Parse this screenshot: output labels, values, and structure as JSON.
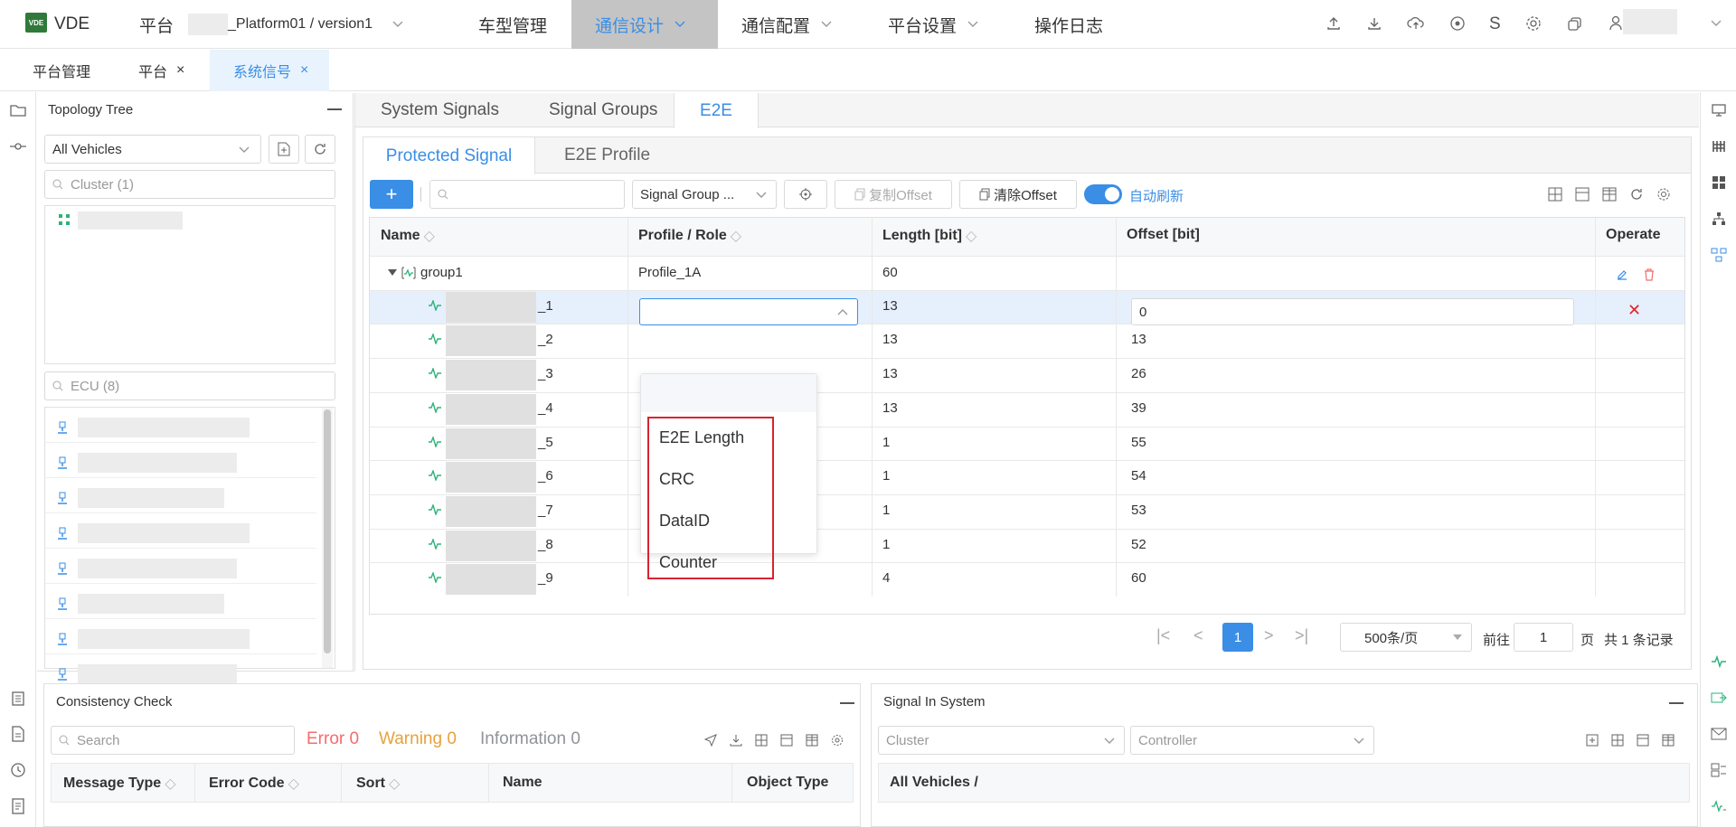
{
  "app": {
    "name": "VDE",
    "logo_text": "VDE"
  },
  "nav": {
    "platform_label": "平台",
    "platform_value": "_Platform01 / version1",
    "items": [
      {
        "label": "车型管理"
      },
      {
        "label": "通信设计",
        "active": true
      },
      {
        "label": "通信配置"
      },
      {
        "label": "平台设置"
      },
      {
        "label": "操作日志"
      }
    ],
    "user_initial": "S"
  },
  "page_tabs": [
    {
      "label": "平台管理",
      "closable": false
    },
    {
      "label": "平台",
      "closable": true
    },
    {
      "label": "系统信号",
      "closable": true,
      "active": true
    }
  ],
  "topology": {
    "title": "Topology Tree",
    "vehicle_select": "All Vehicles",
    "cluster_placeholder": "Cluster (1)",
    "ecu_placeholder": "ECU (8)"
  },
  "main_tabs": [
    "System Signals",
    "Signal Groups",
    "E2E"
  ],
  "sub_tabs": [
    "Protected Signal",
    "E2E Profile"
  ],
  "toolbar": {
    "add_label": "+",
    "search_placeholder": "",
    "group_select": "Signal Group ...",
    "copy_offset": "复制Offset",
    "clear_offset": "清除Offset",
    "auto_refresh": "自动刷新"
  },
  "table": {
    "columns": [
      "Name",
      "Profile / Role",
      "Length [bit]",
      "Offset [bit]",
      "Operate"
    ],
    "group_row": {
      "name": "group1",
      "profile": "Profile_1A",
      "length": "60",
      "offset": ""
    },
    "rows": [
      {
        "suffix": "_1",
        "profile": "",
        "length": "13",
        "offset": "0",
        "editing": true
      },
      {
        "suffix": "_2",
        "profile": "",
        "length": "13",
        "offset": "13"
      },
      {
        "suffix": "_3",
        "profile": "",
        "length": "13",
        "offset": "26"
      },
      {
        "suffix": "_4",
        "profile": "",
        "length": "13",
        "offset": "39"
      },
      {
        "suffix": "_5",
        "profile": "",
        "length": "1",
        "offset": "55"
      },
      {
        "suffix": "_6",
        "profile": "",
        "length": "1",
        "offset": "54"
      },
      {
        "suffix": "_7",
        "profile": "",
        "length": "1",
        "offset": "53"
      },
      {
        "suffix": "_8",
        "profile": "",
        "length": "1",
        "offset": "52"
      },
      {
        "suffix": "_9",
        "profile": "",
        "length": "4",
        "offset": "60"
      }
    ],
    "dropdown_options": [
      "E2E Length",
      "CRC",
      "DataID",
      "Counter"
    ]
  },
  "pagination": {
    "current_page": "1",
    "page_size": "500条/页",
    "goto_label": "前往",
    "goto_value": "1",
    "page_unit": "页",
    "total": "共 1 条记录"
  },
  "consistency": {
    "title": "Consistency Check",
    "search_placeholder": "Search",
    "error": "Error 0",
    "warning": "Warning 0",
    "information": "Information 0",
    "columns": [
      "Message Type",
      "Error Code",
      "Sort",
      "Name",
      "Object Type"
    ]
  },
  "signal_in_system": {
    "title": "Signal In System",
    "cluster_placeholder": "Cluster",
    "controller_placeholder": "Controller",
    "header": "All Vehicles /"
  },
  "colors": {
    "accent": "#3a8ee6",
    "error": "#f56c6c",
    "warning": "#e6a23c",
    "info": "#909399",
    "signal_green": "#2bb37a",
    "highlight_box": "#d9232f"
  }
}
